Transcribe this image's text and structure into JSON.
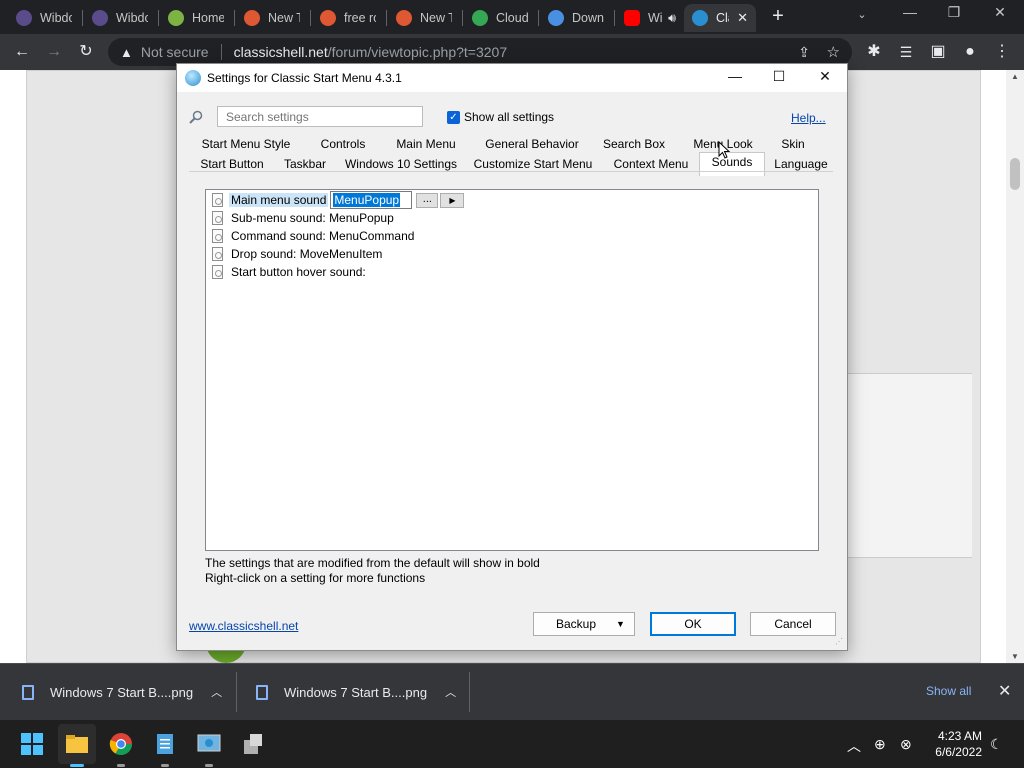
{
  "browser": {
    "tabs": [
      {
        "label": "Wibdo",
        "color": "#5a4b8a"
      },
      {
        "label": "Wibdo",
        "color": "#5a4b8a"
      },
      {
        "label": "Home",
        "color": "#7cb342"
      },
      {
        "label": "New T",
        "color": "#de5833"
      },
      {
        "label": "free ro",
        "color": "#de5833"
      },
      {
        "label": "New T",
        "color": "#de5833"
      },
      {
        "label": "Cloudi",
        "color": "#34a853"
      },
      {
        "label": "Down",
        "color": "#4a90e2"
      },
      {
        "label": "Wi",
        "color": "#ff0000"
      },
      {
        "label": "Cla",
        "color": "#2a8fcf",
        "active": true
      }
    ],
    "omnibox": {
      "security_label": "Not secure",
      "host": "classicshell.net",
      "path": "/forum/viewtopic.php?t=3207"
    }
  },
  "dialog": {
    "title": "Settings for Classic Start Menu 4.3.1",
    "search_placeholder": "Search settings",
    "show_all_label": "Show all settings",
    "help_label": "Help...",
    "tabs_row1": [
      "Start Menu Style",
      "Controls",
      "Main Menu",
      "General Behavior",
      "Search Box",
      "Menu Look",
      "Skin"
    ],
    "tabs_row2": [
      "Start Button",
      "Taskbar",
      "Windows 10 Settings",
      "Customize Start Menu",
      "Context Menu",
      "Sounds",
      "Language"
    ],
    "selected_tab": "Sounds",
    "settings": {
      "main_menu_label": "Main menu sound",
      "main_menu_value": "MenuPopup",
      "browse_label": "...",
      "items": [
        "Sub-menu sound: MenuPopup",
        "Command sound: MenuCommand",
        "Drop sound: MoveMenuItem",
        "Start button hover sound:"
      ]
    },
    "note1": "The settings that are modified from the default will show in bold",
    "note2": "Right-click on a setting for more functions",
    "website_link": "www.classicshell.net",
    "backup_label": "Backup",
    "ok_label": "OK",
    "cancel_label": "Cancel"
  },
  "downloads": {
    "items": [
      "Windows 7 Start B....png",
      "Windows 7 Start B....png"
    ],
    "show_all_label": "Show all"
  },
  "taskbar": {
    "time": "4:23 AM",
    "date": "6/6/2022"
  }
}
